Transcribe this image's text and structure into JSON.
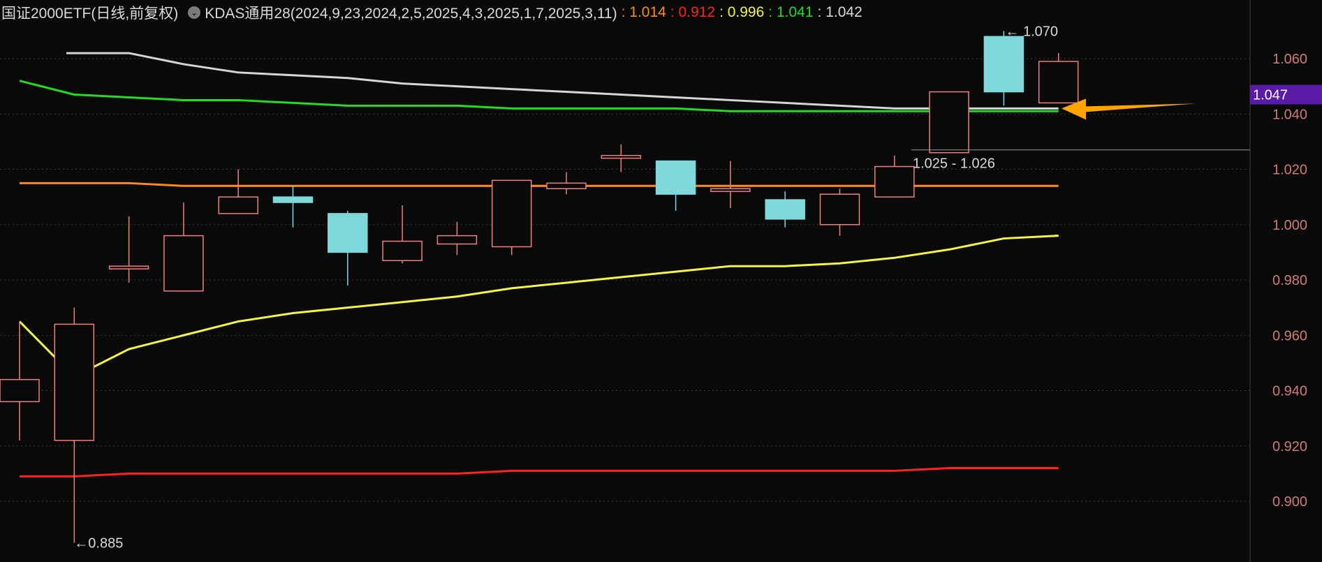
{
  "header": {
    "title": "国证2000ETF(日线,前复权)",
    "menu_icon": "chevron-down-circle-icon",
    "indicator": "KDAS通用28(2024,9,23,2024,2,5,2025,4,3,2025,1,7,2025,3,11)",
    "values": [
      {
        "label": ": 1.014",
        "color": "#ff8c1a"
      },
      {
        "label": ": 0.912",
        "color": "#ff2020"
      },
      {
        "label": ": 0.996",
        "color": "#f5f542"
      },
      {
        "label": ": 1.041",
        "color": "#22dd22"
      },
      {
        "label": ": 1.042",
        "color": "#d9d9d9"
      }
    ]
  },
  "chart_data": {
    "type": "candlestick",
    "y_axis": {
      "range": [
        0.885,
        1.078
      ],
      "ticks": [
        "1.060",
        "1.040",
        "1.020",
        "1.000",
        "0.980",
        "0.960",
        "0.940",
        "0.920",
        "0.900"
      ],
      "tick_values": [
        1.06,
        1.04,
        1.02,
        1.0,
        0.98,
        0.96,
        0.94,
        0.92,
        0.9
      ],
      "grid": "dotted"
    },
    "current_price": {
      "label": "1.047",
      "value": 1.047,
      "color": "#5a1aa8"
    },
    "annotations": {
      "high": {
        "label": "1.070",
        "value": 1.07
      },
      "low": {
        "label": "0.885",
        "value": 0.885
      },
      "range_label": "1.025 - 1.026",
      "range_value": 1.0255
    },
    "candles": [
      {
        "open": 0.936,
        "close": 0.944,
        "high": 0.965,
        "low": 0.922
      },
      {
        "open": 0.922,
        "close": 0.964,
        "high": 0.97,
        "low": 0.885
      },
      {
        "open": 0.984,
        "close": 0.985,
        "high": 1.003,
        "low": 0.979
      },
      {
        "open": 0.976,
        "close": 0.996,
        "high": 1.008,
        "low": 0.976
      },
      {
        "open": 1.004,
        "close": 1.01,
        "high": 1.02,
        "low": 1.004
      },
      {
        "open": 1.01,
        "close": 1.008,
        "high": 1.014,
        "low": 0.999
      },
      {
        "open": 1.004,
        "close": 0.99,
        "high": 1.005,
        "low": 0.978
      },
      {
        "open": 0.987,
        "close": 0.994,
        "high": 1.007,
        "low": 0.986
      },
      {
        "open": 0.993,
        "close": 0.996,
        "high": 1.001,
        "low": 0.989
      },
      {
        "open": 0.992,
        "close": 1.016,
        "high": 1.016,
        "low": 0.989
      },
      {
        "open": 1.013,
        "close": 1.015,
        "high": 1.019,
        "low": 1.011
      },
      {
        "open": 1.024,
        "close": 1.025,
        "high": 1.029,
        "low": 1.019
      },
      {
        "open": 1.023,
        "close": 1.011,
        "high": 1.023,
        "low": 1.005
      },
      {
        "open": 1.012,
        "close": 1.013,
        "high": 1.023,
        "low": 1.006
      },
      {
        "open": 1.009,
        "close": 1.002,
        "high": 1.012,
        "low": 0.999
      },
      {
        "open": 1.0,
        "close": 1.011,
        "high": 1.013,
        "low": 0.996
      },
      {
        "open": 1.01,
        "close": 1.021,
        "high": 1.025,
        "low": 1.01
      },
      {
        "open": 1.026,
        "close": 1.048,
        "high": 1.048,
        "low": 1.026
      },
      {
        "open": 1.068,
        "close": 1.048,
        "high": 1.07,
        "low": 1.043
      },
      {
        "open": 1.044,
        "close": 1.059,
        "high": 1.062,
        "low": 1.044
      }
    ],
    "lines": [
      {
        "color": "#ff8c1a",
        "values": [
          1.015,
          1.015,
          1.015,
          1.014,
          1.014,
          1.014,
          1.014,
          1.014,
          1.014,
          1.014,
          1.014,
          1.014,
          1.014,
          1.014,
          1.014,
          1.014,
          1.014,
          1.014,
          1.014,
          1.014
        ]
      },
      {
        "color": "#ff2020",
        "values": [
          0.909,
          0.909,
          0.91,
          0.91,
          0.91,
          0.91,
          0.91,
          0.91,
          0.91,
          0.911,
          0.911,
          0.911,
          0.911,
          0.911,
          0.911,
          0.911,
          0.911,
          0.912,
          0.912,
          0.912
        ]
      },
      {
        "color": "#f5f542",
        "values": [
          0.965,
          0.945,
          0.955,
          0.96,
          0.965,
          0.968,
          0.97,
          0.972,
          0.974,
          0.977,
          0.979,
          0.981,
          0.983,
          0.985,
          0.985,
          0.986,
          0.988,
          0.991,
          0.995,
          0.996
        ]
      },
      {
        "color": "#22dd22",
        "values": [
          1.052,
          1.047,
          1.046,
          1.045,
          1.045,
          1.044,
          1.043,
          1.043,
          1.043,
          1.042,
          1.042,
          1.042,
          1.042,
          1.041,
          1.041,
          1.041,
          1.041,
          1.041,
          1.041,
          1.041
        ]
      },
      {
        "color": "#d6d6d6",
        "start": 2,
        "values": [
          null,
          null,
          1.062,
          1.058,
          1.055,
          1.054,
          1.053,
          1.051,
          1.05,
          1.049,
          1.048,
          1.047,
          1.046,
          1.045,
          1.044,
          1.043,
          1.042,
          1.042,
          1.042,
          1.042
        ]
      }
    ],
    "arrow": {
      "value": 1.042,
      "color": "#ffa500"
    }
  }
}
